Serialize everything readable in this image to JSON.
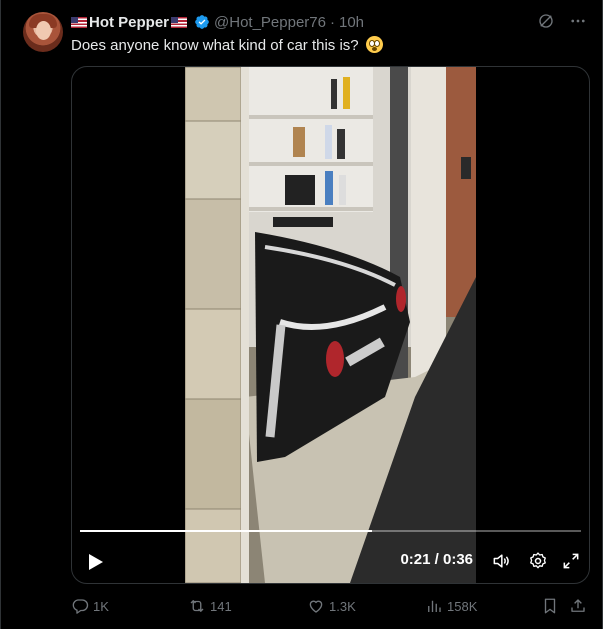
{
  "tweet": {
    "display_name": "Hot Pepper",
    "handle": "@Hot_Pepper76",
    "separator": "·",
    "timestamp": "10h",
    "text": "Does anyone know what kind of car this is?"
  },
  "video": {
    "current_time": "0:21",
    "duration": "0:36",
    "time_display": "0:21 / 0:36",
    "progress_fraction": 0.583
  },
  "actions": {
    "replies": "1K",
    "reposts": "141",
    "likes": "1.3K",
    "views": "158K"
  },
  "icons": {
    "verified": "verified-badge-icon",
    "grok": "grok-icon",
    "more": "more-icon",
    "play": "play-icon",
    "volume": "volume-icon",
    "settings": "gear-icon",
    "fullscreen": "expand-icon",
    "reply": "reply-icon",
    "repost": "repost-icon",
    "like": "heart-icon",
    "views": "views-icon",
    "bookmark": "bookmark-icon",
    "share": "share-icon"
  },
  "colors": {
    "background": "#000000",
    "text": "#e7e9ea",
    "muted": "#71767b",
    "verified": "#1d9bf0",
    "border": "#2f3336"
  }
}
